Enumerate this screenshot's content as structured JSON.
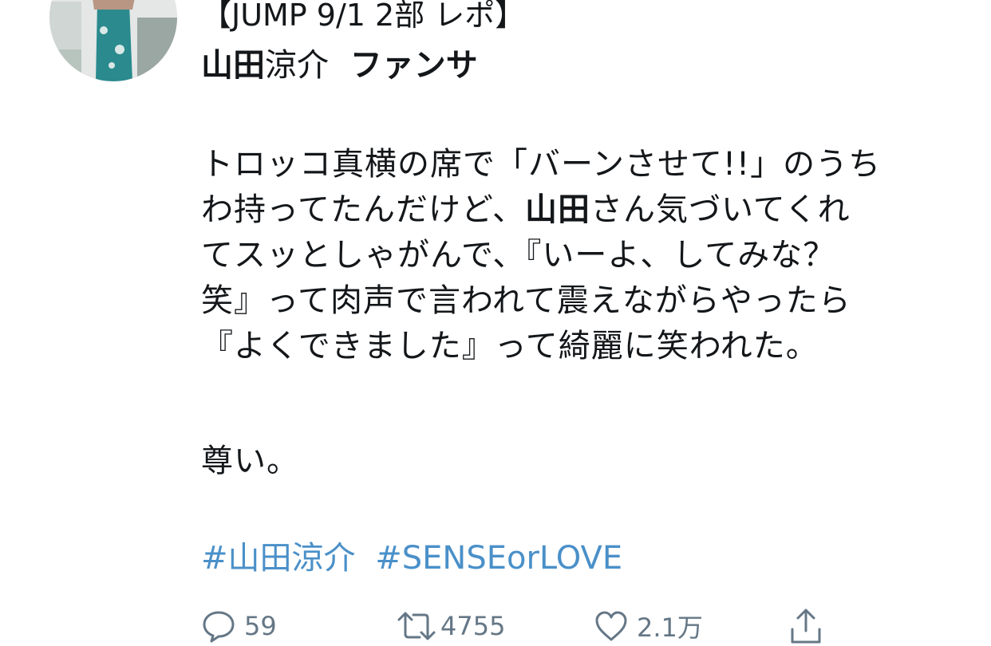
{
  "tweet": {
    "title_line1": "【JUMP 9/1 2部 レポ】",
    "title_line2": {
      "part1": "山田",
      "part2": "涼介",
      "part3": "ファンサ"
    },
    "body_lines": [
      {
        "a": "トロッコ真横の席で「バーンさせて!!」のうち",
        "b": "",
        "c": ""
      },
      {
        "a": "わ持ってたんだけど、",
        "b": "山田",
        "c": "さん気づいてくれ"
      },
      {
        "a": "てスッとしゃがんで、『いーよ、してみな？",
        "b": "",
        "c": ""
      },
      {
        "a": "笑』って肉声で言われて震えながらやったら",
        "b": "",
        "c": ""
      },
      {
        "a": "『よくできました』って綺麗に笑われた。",
        "b": "",
        "c": ""
      }
    ],
    "closing": "尊い。",
    "hashtags": [
      "#山田涼介",
      "#SENSEorLOVE"
    ]
  },
  "actions": {
    "reply_count": "59",
    "retweet_count": "4755",
    "like_count": "2.1万"
  },
  "icons": {
    "reply": "reply-icon",
    "retweet": "retweet-icon",
    "like": "heart-icon",
    "share": "share-icon"
  },
  "colors": {
    "hashtag": "#4a90c9",
    "icon": "#657786",
    "text": "#14171a"
  }
}
